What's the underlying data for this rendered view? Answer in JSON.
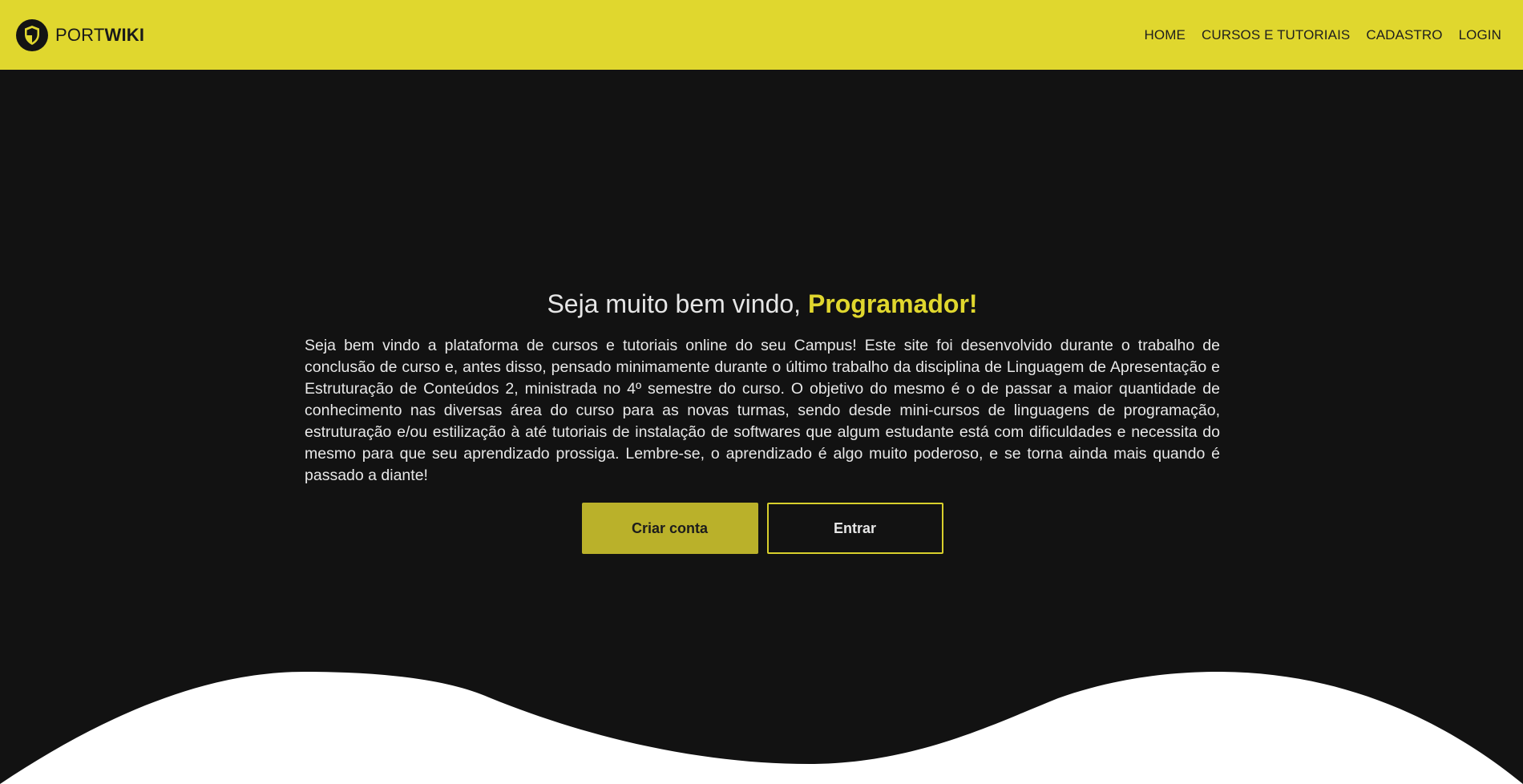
{
  "brand": {
    "name_light": "PORT",
    "name_bold": "WIKI",
    "logo_icon": "shield-icon"
  },
  "nav": {
    "items": [
      {
        "label": "HOME"
      },
      {
        "label": "CURSOS E TUTORIAIS"
      },
      {
        "label": "CADASTRO"
      },
      {
        "label": "LOGIN"
      }
    ]
  },
  "hero": {
    "title_prefix": "Seja muito bem vindo, ",
    "title_accent": "Programador!",
    "paragraph": "Seja bem vindo a plataforma de cursos e tutoriais online do seu Campus! Este site foi desenvolvido durante o trabalho de conclusão de curso e, antes disso, pensado minimamente durante o último trabalho da disciplina de Linguagem de Apresentação e Estruturação de Conteúdos 2, ministrada no 4º semestre do curso. O objetivo do mesmo é o de passar a maior quantidade de conhecimento nas diversas área do curso para as novas turmas, sendo desde mini-cursos de linguagens de programação, estruturação e/ou estilização à até tutoriais de instalação de softwares que algum estudante está com dificuldades e necessita do mesmo para que seu aprendizado prossiga. Lembre-se, o aprendizado é algo muito poderoso, e se torna ainda mais quando é passado a diante!",
    "primary_button": "Criar conta",
    "secondary_button": "Entrar"
  },
  "colors": {
    "accent": "#e0d72e",
    "primary_button_bg": "#bab12a",
    "background": "#121212",
    "wave": "#ffffff"
  }
}
